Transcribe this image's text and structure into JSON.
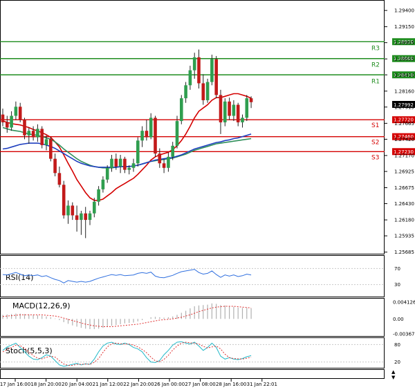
{
  "chart_data": [
    {
      "type": "candlestick",
      "panel": "price",
      "y_ticks": [
        "1.29400",
        "1.29150",
        "1.28905",
        "1.28655",
        "1.28410",
        "1.28160",
        "1.27915",
        "1.27665",
        "1.27420",
        "1.27170",
        "1.26925",
        "1.26675",
        "1.26430",
        "1.26180",
        "1.25935",
        "1.25685"
      ],
      "ylim": [
        1.2566,
        1.2955
      ],
      "current_price": "1.27992",
      "levels": [
        {
          "name": "R3",
          "value": 1.2892,
          "label": "1.28920",
          "color": "#1e8c1e"
        },
        {
          "name": "R2",
          "value": 1.2866,
          "label": "1.28660",
          "color": "#1e8c1e"
        },
        {
          "name": "R1",
          "value": 1.2841,
          "label": "1.28410",
          "color": "#1e8c1e"
        },
        {
          "name": "S1",
          "value": 1.2772,
          "label": "1.27720",
          "color": "#d40000"
        },
        {
          "name": "S2",
          "value": 1.2746,
          "label": "1.27460",
          "color": "#d40000"
        },
        {
          "name": "S3",
          "value": 1.2723,
          "label": "1.27230",
          "color": "#d40000"
        }
      ],
      "candles": [
        {
          "o": 1.278,
          "h": 1.2789,
          "l": 1.2762,
          "c": 1.2768
        },
        {
          "o": 1.2768,
          "h": 1.2778,
          "l": 1.2752,
          "c": 1.276
        },
        {
          "o": 1.276,
          "h": 1.2785,
          "l": 1.2755,
          "c": 1.2778
        },
        {
          "o": 1.2778,
          "h": 1.28,
          "l": 1.2772,
          "c": 1.2792
        },
        {
          "o": 1.2792,
          "h": 1.2798,
          "l": 1.2768,
          "c": 1.2772
        },
        {
          "o": 1.2772,
          "h": 1.2775,
          "l": 1.2742,
          "c": 1.2748
        },
        {
          "o": 1.2748,
          "h": 1.276,
          "l": 1.2735,
          "c": 1.2755
        },
        {
          "o": 1.2755,
          "h": 1.2762,
          "l": 1.274,
          "c": 1.2745
        },
        {
          "o": 1.2745,
          "h": 1.2765,
          "l": 1.2738,
          "c": 1.2758
        },
        {
          "o": 1.2758,
          "h": 1.2762,
          "l": 1.2728,
          "c": 1.2733
        },
        {
          "o": 1.2733,
          "h": 1.2748,
          "l": 1.2725,
          "c": 1.2742
        },
        {
          "o": 1.2742,
          "h": 1.2745,
          "l": 1.2708,
          "c": 1.2712
        },
        {
          "o": 1.2712,
          "h": 1.272,
          "l": 1.2685,
          "c": 1.269
        },
        {
          "o": 1.269,
          "h": 1.27,
          "l": 1.2668,
          "c": 1.2672
        },
        {
          "o": 1.2672,
          "h": 1.2678,
          "l": 1.262,
          "c": 1.2625
        },
        {
          "o": 1.2625,
          "h": 1.2648,
          "l": 1.2612,
          "c": 1.264
        },
        {
          "o": 1.264,
          "h": 1.2645,
          "l": 1.2618,
          "c": 1.2625
        },
        {
          "o": 1.2625,
          "h": 1.264,
          "l": 1.26,
          "c": 1.2618
        },
        {
          "o": 1.2618,
          "h": 1.2632,
          "l": 1.2595,
          "c": 1.2628
        },
        {
          "o": 1.2628,
          "h": 1.2638,
          "l": 1.259,
          "c": 1.2618
        },
        {
          "o": 1.2618,
          "h": 1.2632,
          "l": 1.261,
          "c": 1.2628
        },
        {
          "o": 1.2628,
          "h": 1.2652,
          "l": 1.2622,
          "c": 1.2646
        },
        {
          "o": 1.2646,
          "h": 1.267,
          "l": 1.264,
          "c": 1.2665
        },
        {
          "o": 1.2665,
          "h": 1.2685,
          "l": 1.266,
          "c": 1.268
        },
        {
          "o": 1.268,
          "h": 1.2702,
          "l": 1.2675,
          "c": 1.2698
        },
        {
          "o": 1.2698,
          "h": 1.2718,
          "l": 1.2692,
          "c": 1.2712
        },
        {
          "o": 1.2712,
          "h": 1.272,
          "l": 1.2695,
          "c": 1.27
        },
        {
          "o": 1.27,
          "h": 1.2718,
          "l": 1.269,
          "c": 1.2712
        },
        {
          "o": 1.2712,
          "h": 1.2715,
          "l": 1.269,
          "c": 1.2695
        },
        {
          "o": 1.2695,
          "h": 1.2702,
          "l": 1.2688,
          "c": 1.2698
        },
        {
          "o": 1.2698,
          "h": 1.2712,
          "l": 1.2692,
          "c": 1.2705
        },
        {
          "o": 1.2705,
          "h": 1.2745,
          "l": 1.27,
          "c": 1.274
        },
        {
          "o": 1.274,
          "h": 1.2762,
          "l": 1.273,
          "c": 1.2755
        },
        {
          "o": 1.2755,
          "h": 1.2772,
          "l": 1.274,
          "c": 1.2745
        },
        {
          "o": 1.2745,
          "h": 1.2782,
          "l": 1.2742,
          "c": 1.2775
        },
        {
          "o": 1.2775,
          "h": 1.2778,
          "l": 1.2715,
          "c": 1.272
        },
        {
          "o": 1.272,
          "h": 1.2728,
          "l": 1.2698,
          "c": 1.2705
        },
        {
          "o": 1.2705,
          "h": 1.2712,
          "l": 1.269,
          "c": 1.2698
        },
        {
          "o": 1.2698,
          "h": 1.2722,
          "l": 1.2692,
          "c": 1.2715
        },
        {
          "o": 1.2715,
          "h": 1.2738,
          "l": 1.271,
          "c": 1.2732
        },
        {
          "o": 1.2732,
          "h": 1.2778,
          "l": 1.2728,
          "c": 1.277
        },
        {
          "o": 1.277,
          "h": 1.281,
          "l": 1.2765,
          "c": 1.2805
        },
        {
          "o": 1.2805,
          "h": 1.283,
          "l": 1.2798,
          "c": 1.2825
        },
        {
          "o": 1.2825,
          "h": 1.2855,
          "l": 1.2818,
          "c": 1.2848
        },
        {
          "o": 1.2848,
          "h": 1.2875,
          "l": 1.2835,
          "c": 1.2868
        },
        {
          "o": 1.2868,
          "h": 1.288,
          "l": 1.282,
          "c": 1.2828
        },
        {
          "o": 1.2828,
          "h": 1.2842,
          "l": 1.2795,
          "c": 1.2802
        },
        {
          "o": 1.2802,
          "h": 1.2835,
          "l": 1.2798,
          "c": 1.283
        },
        {
          "o": 1.283,
          "h": 1.2872,
          "l": 1.2825,
          "c": 1.2865
        },
        {
          "o": 1.2865,
          "h": 1.287,
          "l": 1.2805,
          "c": 1.281
        },
        {
          "o": 1.281,
          "h": 1.2818,
          "l": 1.275,
          "c": 1.2768
        },
        {
          "o": 1.2768,
          "h": 1.2805,
          "l": 1.2762,
          "c": 1.28
        },
        {
          "o": 1.28,
          "h": 1.2806,
          "l": 1.2772,
          "c": 1.2778
        },
        {
          "o": 1.2778,
          "h": 1.2802,
          "l": 1.277,
          "c": 1.2795
        },
        {
          "o": 1.2795,
          "h": 1.2798,
          "l": 1.2762,
          "c": 1.2768
        },
        {
          "o": 1.2768,
          "h": 1.278,
          "l": 1.276,
          "c": 1.2775
        },
        {
          "o": 1.2775,
          "h": 1.281,
          "l": 1.277,
          "c": 1.2805
        },
        {
          "o": 1.2805,
          "h": 1.2808,
          "l": 1.279,
          "c": 1.2799
        }
      ],
      "moving_averages": [
        {
          "color": "#d40000",
          "values": [
            1.277,
            1.2768,
            1.2766,
            1.2765,
            1.2764,
            1.2762,
            1.276,
            1.2757,
            1.2755,
            1.2752,
            1.2749,
            1.2745,
            1.2738,
            1.273,
            1.2718,
            1.2705,
            1.2693,
            1.268,
            1.267,
            1.266,
            1.2652,
            1.2648,
            1.2648,
            1.265,
            1.2655,
            1.266,
            1.2666,
            1.267,
            1.2674,
            1.2678,
            1.2682,
            1.2688,
            1.2695,
            1.2702,
            1.271,
            1.2715,
            1.2718,
            1.272,
            1.2722,
            1.2726,
            1.2732,
            1.274,
            1.275,
            1.2762,
            1.2775,
            1.2785,
            1.279,
            1.2795,
            1.2802,
            1.2806,
            1.2806,
            1.2808,
            1.281,
            1.2812,
            1.2812,
            1.281,
            1.2808,
            1.2805
          ]
        },
        {
          "color": "#2f8f5a",
          "values": [
            1.276,
            1.2758,
            1.2756,
            1.2755,
            1.2754,
            1.2752,
            1.275,
            1.2749,
            1.2748,
            1.2746,
            1.2744,
            1.2742,
            1.2738,
            1.2733,
            1.2727,
            1.2722,
            1.2717,
            1.2712,
            1.2708,
            1.2705,
            1.2702,
            1.27,
            1.2699,
            1.2698,
            1.2698,
            1.2698,
            1.2699,
            1.27,
            1.27,
            1.27,
            1.2701,
            1.2702,
            1.2704,
            1.2706,
            1.2708,
            1.2709,
            1.271,
            1.2711,
            1.2712,
            1.2713,
            1.2715,
            1.2717,
            1.2719,
            1.2722,
            1.2725,
            1.2727,
            1.2729,
            1.2731,
            1.2733,
            1.2735,
            1.2736,
            1.2737,
            1.2738,
            1.2739,
            1.274,
            1.2741,
            1.2742,
            1.2743
          ]
        },
        {
          "color": "#1f3fbf",
          "values": [
            1.2727,
            1.2728,
            1.273,
            1.2732,
            1.2734,
            1.2735,
            1.2736,
            1.2736,
            1.2736,
            1.2735,
            1.2733,
            1.2731,
            1.2728,
            1.2724,
            1.272,
            1.2716,
            1.2712,
            1.2708,
            1.2705,
            1.2703,
            1.2701,
            1.27,
            1.2699,
            1.2699,
            1.2699,
            1.2699,
            1.2699,
            1.27,
            1.27,
            1.27,
            1.2701,
            1.2702,
            1.2704,
            1.2706,
            1.2708,
            1.271,
            1.2711,
            1.2712,
            1.2713,
            1.2714,
            1.2716,
            1.2718,
            1.2721,
            1.2724,
            1.2727,
            1.2729,
            1.2731,
            1.2733,
            1.2735,
            1.2737,
            1.2738,
            1.274,
            1.2741,
            1.2743,
            1.2744,
            1.2746,
            1.2748,
            1.275
          ]
        }
      ]
    },
    {
      "type": "line",
      "panel": "rsi",
      "title": "RSI(14)",
      "y_ticks": [
        "70",
        "30"
      ],
      "ylim": [
        0,
        100
      ],
      "series": [
        {
          "color": "#2f6fdf",
          "values": [
            55,
            54,
            57,
            60,
            56,
            52,
            54,
            52,
            54,
            50,
            52,
            47,
            43,
            40,
            34,
            40,
            38,
            36,
            38,
            36,
            38,
            42,
            46,
            49,
            52,
            55,
            53,
            55,
            52,
            53,
            54,
            58,
            60,
            58,
            61,
            51,
            48,
            47,
            50,
            53,
            58,
            62,
            64,
            66,
            68,
            60,
            56,
            58,
            64,
            55,
            48,
            54,
            51,
            54,
            50,
            52,
            56,
            54
          ]
        }
      ]
    },
    {
      "type": "bar+line",
      "panel": "macd",
      "title": "MACD(12,26,9)",
      "y_ticks": [
        "0.004126",
        "0.00",
        "-0.00367"
      ],
      "ylim": [
        -0.0042,
        0.0048
      ],
      "histogram": {
        "color": "#b0b0b0",
        "values": [
          0.001,
          0.0011,
          0.0012,
          0.0013,
          0.0013,
          0.0012,
          0.0011,
          0.001,
          0.0009,
          0.0008,
          0.0006,
          0.0004,
          0.0001,
          -0.0003,
          -0.0008,
          -0.0012,
          -0.0016,
          -0.0019,
          -0.0022,
          -0.0024,
          -0.0025,
          -0.0025,
          -0.0024,
          -0.0022,
          -0.002,
          -0.0017,
          -0.0015,
          -0.0013,
          -0.0011,
          -0.001,
          -0.0009,
          -0.0006,
          -0.0003,
          0.0,
          0.0004,
          0.0005,
          0.0004,
          0.0003,
          0.0004,
          0.0006,
          0.001,
          0.0015,
          0.002,
          0.0026,
          0.0031,
          0.0033,
          0.0034,
          0.0035,
          0.0038,
          0.0037,
          0.0034,
          0.0033,
          0.0031,
          0.003,
          0.0028,
          0.0027,
          0.0027,
          0.0026
        ]
      },
      "signal": {
        "color": "#e03030",
        "values": [
          0.0006,
          0.0007,
          0.0008,
          0.0009,
          0.001,
          0.001,
          0.001,
          0.001,
          0.001,
          0.001,
          0.0009,
          0.0008,
          0.0007,
          0.0005,
          0.0002,
          -0.0001,
          -0.0004,
          -0.0007,
          -0.001,
          -0.0013,
          -0.0015,
          -0.0017,
          -0.0018,
          -0.0019,
          -0.0019,
          -0.0019,
          -0.0018,
          -0.0017,
          -0.0016,
          -0.0015,
          -0.0014,
          -0.0013,
          -0.0011,
          -0.0009,
          -0.0007,
          -0.0005,
          -0.0003,
          -0.0002,
          -0.0001,
          0.0,
          0.0002,
          0.0004,
          0.0007,
          0.001,
          0.0014,
          0.0018,
          0.0021,
          0.0024,
          0.0027,
          0.0029,
          0.003,
          0.0031,
          0.0031,
          0.0031,
          0.003,
          0.0029,
          0.0028,
          0.0027
        ]
      }
    },
    {
      "type": "line",
      "panel": "stochastic",
      "title": "Stoch(5,5,3)",
      "y_ticks": [
        "80",
        "20"
      ],
      "ylim": [
        0,
        100
      ],
      "series": [
        {
          "color": "#20b8c8",
          "values": [
            60,
            72,
            78,
            85,
            70,
            55,
            40,
            30,
            28,
            35,
            45,
            40,
            25,
            10,
            5,
            8,
            12,
            15,
            10,
            14,
            12,
            30,
            55,
            75,
            85,
            88,
            82,
            80,
            85,
            80,
            70,
            65,
            55,
            35,
            20,
            18,
            25,
            45,
            60,
            78,
            88,
            90,
            85,
            82,
            88,
            75,
            60,
            70,
            85,
            70,
            40,
            30,
            35,
            30,
            28,
            32,
            38,
            42
          ]
        },
        {
          "color": "#e03030",
          "values": [
            55,
            62,
            70,
            78,
            76,
            68,
            55,
            42,
            33,
            31,
            36,
            40,
            37,
            25,
            13,
            8,
            8,
            12,
            12,
            13,
            12,
            19,
            32,
            53,
            72,
            83,
            85,
            83,
            82,
            82,
            78,
            72,
            63,
            52,
            37,
            24,
            21,
            29,
            43,
            61,
            75,
            85,
            88,
            86,
            85,
            82,
            74,
            68,
            72,
            75,
            65,
            47,
            35,
            32,
            31,
            30,
            33,
            37
          ]
        }
      ]
    }
  ],
  "x_axis": {
    "labels": [
      "17 Jan 16:00",
      "18 Jan 20:00",
      "20 Jan 04:00",
      "21 Jan 12:00",
      "22 Jan 20:00",
      "26 Jan 00:00",
      "27 Jan 08:00",
      "28 Jan 16:00",
      "31 Jan 22:01"
    ]
  },
  "colors": {
    "background": "#ffffff",
    "axis": "#000000",
    "grid": "#d8d8d8",
    "bull": "#2f9e4f",
    "bear": "#c21a1a"
  }
}
